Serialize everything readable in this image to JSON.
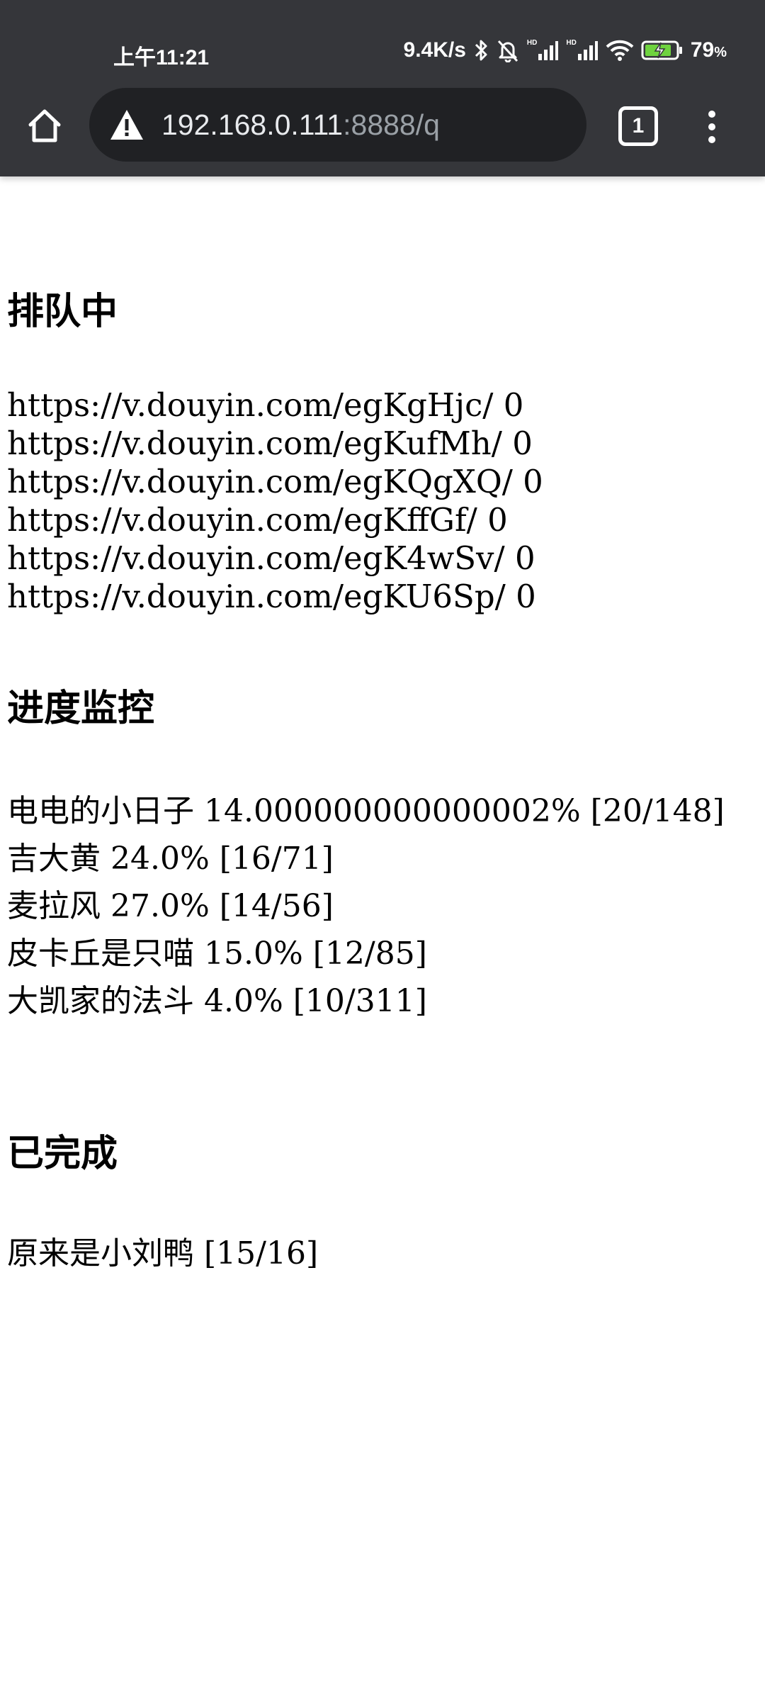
{
  "status_bar": {
    "time": "上午11:21",
    "net_speed": "9.4K/s",
    "hd1": "HD",
    "hd2": "HD",
    "battery": "79",
    "battery_unit": "%"
  },
  "browser": {
    "url_host": "192.168.0.111",
    "url_rest": ":8888/q",
    "tab_count": "1"
  },
  "sections": {
    "queue": {
      "title": "排队中",
      "items": [
        "https://v.douyin.com/egKgHjc/ 0",
        "https://v.douyin.com/egKufMh/ 0",
        "https://v.douyin.com/egKQgXQ/ 0",
        "https://v.douyin.com/egKffGf/ 0",
        "https://v.douyin.com/egK4wSv/ 0",
        "https://v.douyin.com/egKU6Sp/ 0"
      ]
    },
    "progress": {
      "title": "进度监控",
      "items": [
        "电电的小日子 14.000000000000002% [20/148]",
        "吉大黄 24.0% [16/71]",
        "麦拉风 27.0% [14/56]",
        "皮卡丘是只喵 15.0% [12/85]",
        "大凯家的法斗 4.0% [10/311]"
      ]
    },
    "done": {
      "title": "已完成",
      "items": [
        "原来是小刘鸭 [15/16]"
      ]
    }
  }
}
